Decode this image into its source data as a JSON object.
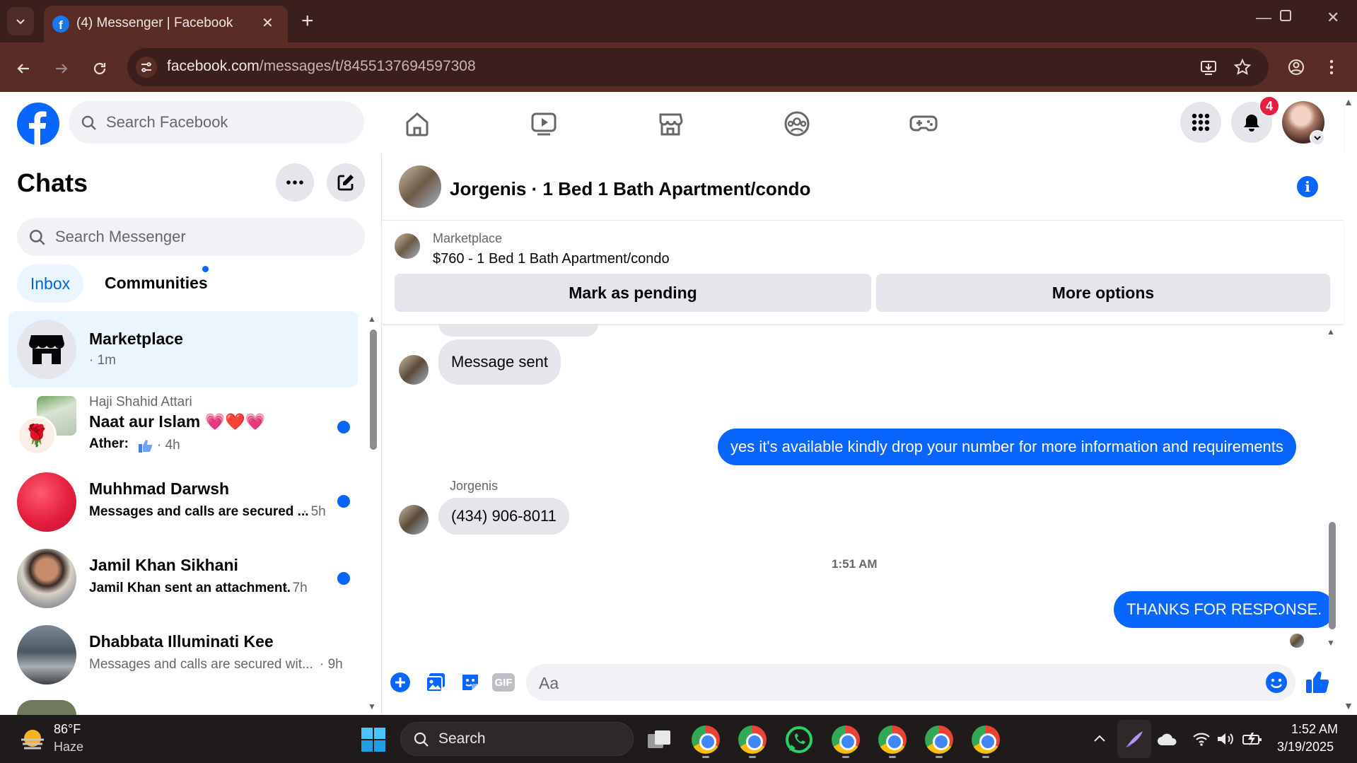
{
  "browser": {
    "tab_title": "(4) Messenger | Facebook",
    "url_host": "facebook.com",
    "url_path": "/messages/t/8455137694597308"
  },
  "fb": {
    "search_placeholder": "Search Facebook",
    "notification_count": "4"
  },
  "chats": {
    "title": "Chats",
    "search_placeholder": "Search Messenger",
    "tabs": [
      "Inbox",
      "Communities"
    ],
    "items": [
      {
        "name": "Marketplace",
        "preview": "· 1m"
      },
      {
        "group_author": "Haji Shahid Attari",
        "name": "Naat aur Islam 💗❤️💗",
        "preview_sender": "Ather:",
        "preview_time": "· 4h"
      },
      {
        "name": "Muhhmad Darwsh",
        "preview": "Messages and calls are secured ...",
        "time": "· 5h"
      },
      {
        "name": "Jamil Khan Sikhani",
        "preview": "Jamil Khan sent an attachment.",
        "time": "· 7h"
      },
      {
        "name": "Dhabbata Illuminati Kee",
        "preview": "Messages and calls are secured wit...",
        "time": "· 9h"
      }
    ]
  },
  "conversation": {
    "title": "Jorgenis · 1 Bed 1 Bath Apartment/condo",
    "marketplace_label": "Marketplace",
    "listing": "$760 - 1 Bed 1 Bath Apartment/condo",
    "mark_pending": "Mark as pending",
    "more_options": "More options",
    "messages": {
      "message_sent": "Message sent",
      "reply_available": "yes it's available kindly drop your number for more information and requirements",
      "sender": "Jorgenis",
      "phone": "(434) 906-8011",
      "time_divider": "1:51 AM",
      "thanks": "THANKS FOR RESPONSE."
    },
    "composer_placeholder": "Aa"
  },
  "taskbar": {
    "temperature": "86°F",
    "weather": "Haze",
    "search": "Search",
    "time": "1:52 AM",
    "date": "3/19/2025"
  },
  "colors": {
    "fb_blue": "#0866ff",
    "bubble_gray": "#e4e6eb",
    "chrome_frame": "#3a1f1c",
    "chrome_toolbar": "#5a2c26",
    "badge_red": "#e41e3f"
  }
}
